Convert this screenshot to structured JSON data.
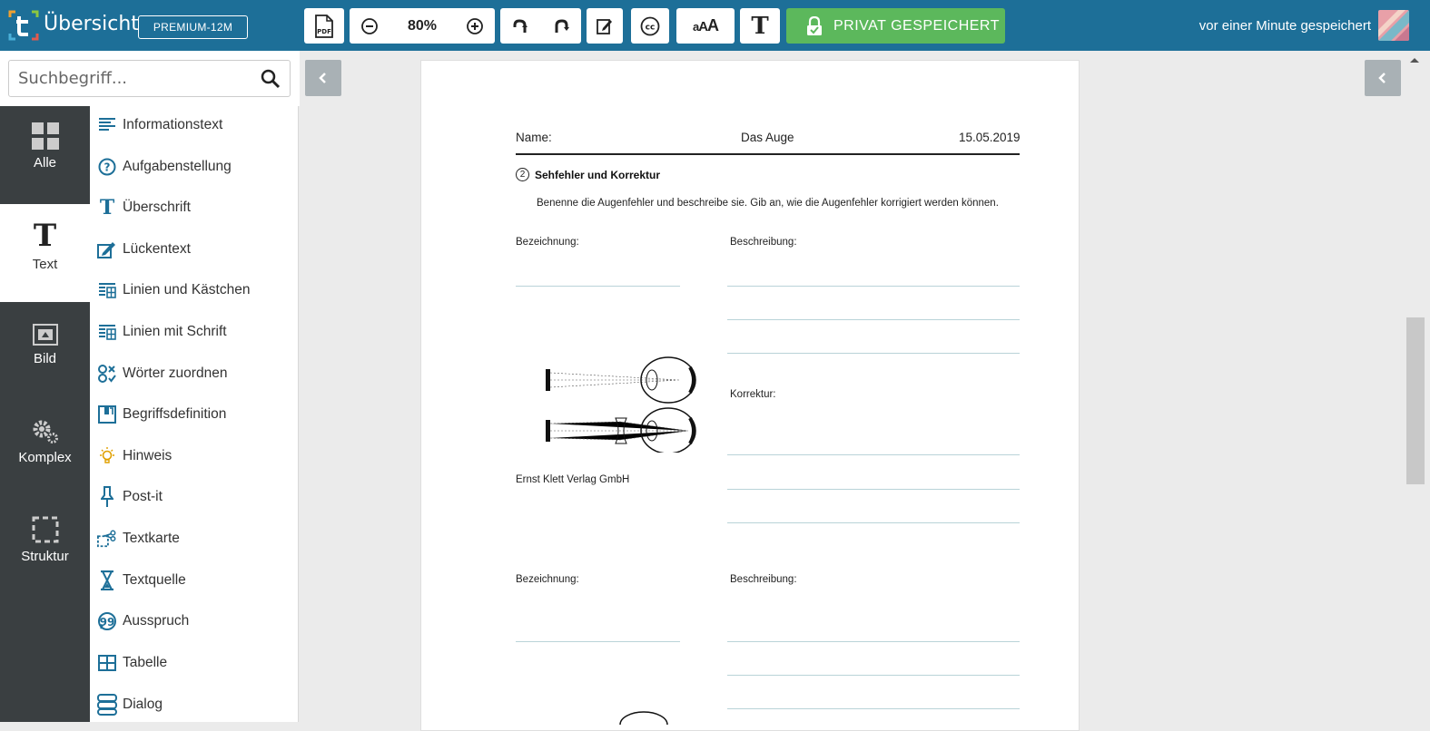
{
  "header": {
    "title": "Übersicht",
    "plan_badge": "PREMIUM-12M",
    "zoom": "80%",
    "font_size_label": "AAA",
    "save_label": "PRIVAT GESPEICHERT",
    "status": "vor einer Minute gespeichert",
    "colors": {
      "bar": "#1d6f98",
      "save": "#5cb85c"
    }
  },
  "toolbar_icons": [
    "pdf-icon",
    "zoom-out-icon",
    "zoom-in-icon",
    "undo-icon",
    "redo-icon",
    "edit-icon",
    "cc-icon",
    "font-size-icon",
    "text-icon",
    "lock-icon"
  ],
  "search": {
    "placeholder": "Suchbegriff..."
  },
  "categories": [
    {
      "label": "Alle",
      "icon": "grid-icon"
    },
    {
      "label": "Text",
      "icon": "text-icon"
    },
    {
      "label": "Bild",
      "icon": "image-icon"
    },
    {
      "label": "Komplex",
      "icon": "gears-icon"
    },
    {
      "label": "Struktur",
      "icon": "structure-icon"
    }
  ],
  "items": [
    {
      "label": "Informationstext",
      "icon": "info-text-icon"
    },
    {
      "label": "Aufgabenstellung",
      "icon": "question-icon"
    },
    {
      "label": "Überschrift",
      "icon": "heading-icon"
    },
    {
      "label": "Lückentext",
      "icon": "cloze-icon"
    },
    {
      "label": "Linien und Kästchen",
      "icon": "lines-boxes-icon"
    },
    {
      "label": "Linien mit Schrift",
      "icon": "lines-script-icon"
    },
    {
      "label": "Wörter zuordnen",
      "icon": "match-words-icon"
    },
    {
      "label": "Begriffsdefinition",
      "icon": "definition-icon"
    },
    {
      "label": "Hinweis",
      "icon": "lightbulb-icon"
    },
    {
      "label": "Post-it",
      "icon": "pin-icon"
    },
    {
      "label": "Textkarte",
      "icon": "scissors-icon"
    },
    {
      "label": "Textquelle",
      "icon": "hourglass-icon"
    },
    {
      "label": "Ausspruch",
      "icon": "quote-icon"
    },
    {
      "label": "Tabelle",
      "icon": "table-icon"
    },
    {
      "label": "Dialog",
      "icon": "dialog-icon"
    }
  ],
  "worksheet": {
    "name_label": "Name:",
    "topic": "Das Auge",
    "date": "15.05.2019",
    "task_number": "2",
    "task_title": "Sehfehler und Korrektur",
    "instruction": "Benenne die Augenfehler und beschreibe sie. Gib an, wie die Augenfehler korrigiert werden können.",
    "label_designation": "Bezeichnung:",
    "label_description": "Beschreibung:",
    "label_correction": "Korrektur:",
    "credit": "Ernst Klett Verlag GmbH",
    "label_designation_2": "Bezeichnung:",
    "label_description_2": "Beschreibung:"
  }
}
